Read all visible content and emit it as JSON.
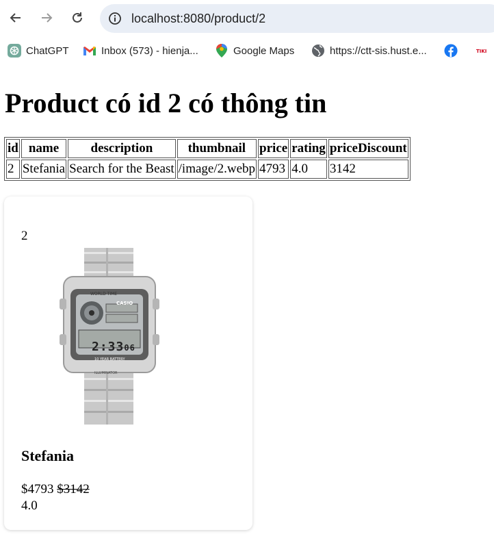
{
  "browser": {
    "url": "localhost:8080/product/2",
    "bookmarks": [
      {
        "label": "ChatGPT",
        "icon": "chatgpt-icon"
      },
      {
        "label": "Inbox (573) - hienja...",
        "icon": "gmail-icon"
      },
      {
        "label": "Google Maps",
        "icon": "google-maps-icon"
      },
      {
        "label": "https://ctt-sis.hust.e...",
        "icon": "globe-icon"
      },
      {
        "label": "",
        "icon": "facebook-icon"
      },
      {
        "label": "",
        "icon": "tiki-icon"
      }
    ]
  },
  "page": {
    "title": "Product có id 2 có thông tin",
    "table": {
      "headers": [
        "id",
        "name",
        "description",
        "thumbnail",
        "price",
        "rating",
        "priceDiscount"
      ],
      "row": [
        "2",
        "Stefania",
        "Search for the Beast",
        "/image/2.webp",
        "4793",
        "4.0",
        "3142"
      ]
    },
    "card": {
      "id": "2",
      "name": "Stefania",
      "price": "$4793",
      "price_discount": "$3142",
      "rating": "4.0",
      "image_alt": "watch-product-image",
      "watch_brand": "CASIO",
      "watch_time": "2:33",
      "watch_seconds": "06",
      "watch_top_text": "WORLD TIME",
      "watch_bottom_text": "ILLUMINATOR",
      "watch_sub_text": "10 YEAR BATTERY"
    }
  },
  "colors": {
    "omnibox_bg": "#e9eef6",
    "facebook_blue": "#1877f2"
  }
}
